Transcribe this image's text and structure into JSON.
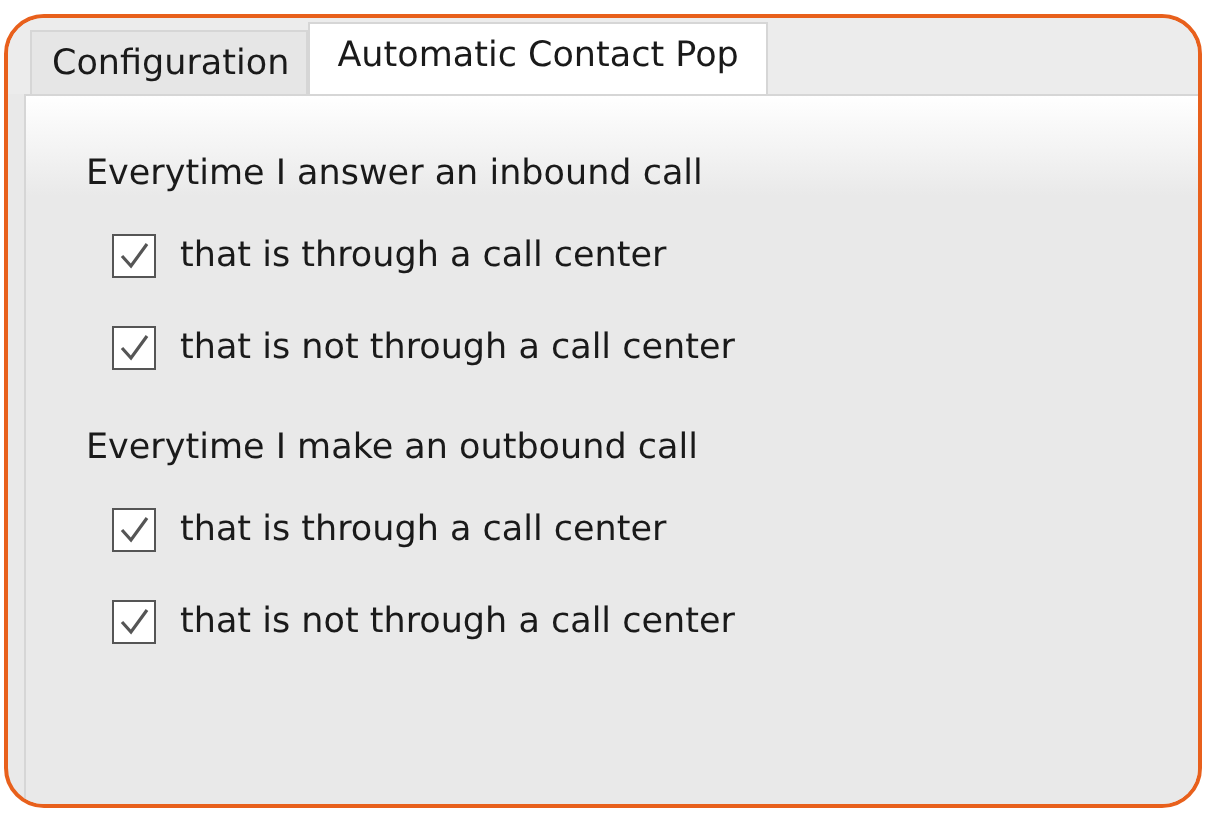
{
  "tabs": [
    {
      "label": "Configuration",
      "selected": false
    },
    {
      "label": "Automatic Contact Pop",
      "selected": true
    }
  ],
  "groups": [
    {
      "heading": "Everytime I answer an inbound call",
      "options": [
        {
          "label": "that is through a call center",
          "checked": true
        },
        {
          "label": "that is not through a call center",
          "checked": true
        }
      ]
    },
    {
      "heading": "Everytime I make an outbound call",
      "options": [
        {
          "label": "that is through a call center",
          "checked": true
        },
        {
          "label": "that is not through a call center",
          "checked": true
        }
      ]
    }
  ]
}
